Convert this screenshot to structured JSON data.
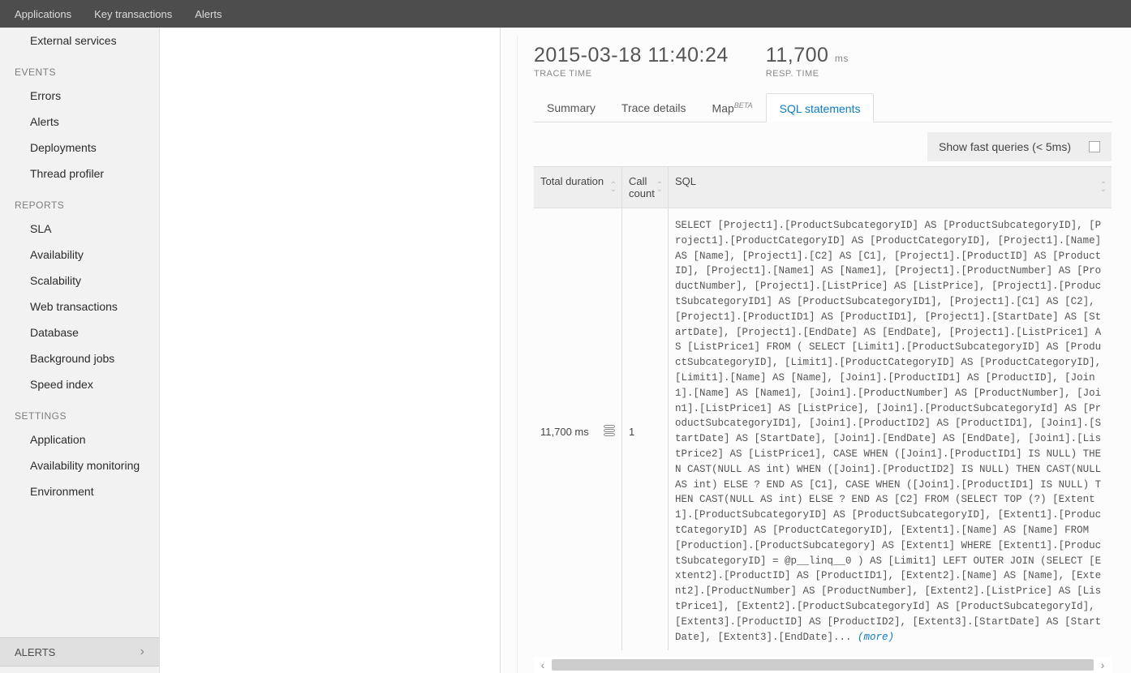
{
  "topnav": {
    "applications": "Applications",
    "key_transactions": "Key transactions",
    "alerts": "Alerts"
  },
  "sidebar": {
    "item_external_services": "External services",
    "section_events": "EVENTS",
    "item_errors": "Errors",
    "item_alerts": "Alerts",
    "item_deployments": "Deployments",
    "item_thread_profiler": "Thread profiler",
    "section_reports": "REPORTS",
    "item_sla": "SLA",
    "item_availability": "Availability",
    "item_scalability": "Scalability",
    "item_web_transactions": "Web transactions",
    "item_database": "Database",
    "item_background_jobs": "Background jobs",
    "item_speed_index": "Speed index",
    "section_settings": "SETTINGS",
    "item_application": "Application",
    "item_availability_monitoring": "Availability monitoring",
    "item_environment": "Environment",
    "footer_alerts": "ALERTS"
  },
  "detail": {
    "trace_time_value": "2015-03-18 11:40:24",
    "trace_time_label": "TRACE TIME",
    "resp_time_value": "11,700",
    "resp_time_unit": "ms",
    "resp_time_label": "RESP. TIME",
    "tabs": {
      "summary": "Summary",
      "trace_details": "Trace details",
      "map": "Map",
      "map_badge": "BETA",
      "sql_statements": "SQL statements"
    },
    "show_fast_queries": "Show fast queries (< 5ms)",
    "columns": {
      "total_duration": "Total duration",
      "call_count": "Call count",
      "sql": "SQL"
    },
    "row0": {
      "duration": "11,700 ms",
      "call_count": "1",
      "sql": "SELECT [Project1].[ProductSubcategoryID] AS [ProductSubcategoryID], [Project1].[ProductCategoryID] AS [ProductCategoryID], [Project1].[Name] AS [Name], [Project1].[C2] AS [C1], [Project1].[ProductID] AS [ProductID], [Project1].[Name1] AS [Name1], [Project1].[ProductNumber] AS [ProductNumber], [Project1].[ListPrice] AS [ListPrice], [Project1].[ProductSubcategoryID1] AS [ProductSubcategoryID1], [Project1].[C1] AS [C2], [Project1].[ProductID1] AS [ProductID1], [Project1].[StartDate] AS [StartDate], [Project1].[EndDate] AS [EndDate], [Project1].[ListPrice1] AS [ListPrice1] FROM ( SELECT [Limit1].[ProductSubcategoryID] AS [ProductSubcategoryID], [Limit1].[ProductCategoryID] AS [ProductCategoryID], [Limit1].[Name] AS [Name], [Join1].[ProductID1] AS [ProductID], [Join1].[Name] AS [Name1], [Join1].[ProductNumber] AS [ProductNumber], [Join1].[ListPrice1] AS [ListPrice], [Join1].[ProductSubcategoryId] AS [ProductSubcategoryID1], [Join1].[ProductID2] AS [ProductID1], [Join1].[StartDate] AS [StartDate], [Join1].[EndDate] AS [EndDate], [Join1].[ListPrice2] AS [ListPrice1], CASE WHEN ([Join1].[ProductID1] IS NULL) THEN CAST(NULL AS int) WHEN ([Join1].[ProductID2] IS NULL) THEN CAST(NULL AS int) ELSE ? END AS [C1], CASE WHEN ([Join1].[ProductID1] IS NULL) THEN CAST(NULL AS int) ELSE ? END AS [C2] FROM (SELECT TOP (?) [Extent1].[ProductSubcategoryID] AS [ProductSubcategoryID], [Extent1].[ProductCategoryID] AS [ProductCategoryID], [Extent1].[Name] AS [Name] FROM [Production].[ProductSubcategory] AS [Extent1] WHERE [Extent1].[ProductSubcategoryID] = @p__linq__0 ) AS [Limit1] LEFT OUTER JOIN (SELECT [Extent2].[ProductID] AS [ProductID1], [Extent2].[Name] AS [Name], [Extent2].[ProductNumber] AS [ProductNumber], [Extent2].[ListPrice] AS [ListPrice1], [Extent2].[ProductSubcategoryId] AS [ProductSubcategoryId], [Extent3].[ProductID] AS [ProductID2], [Extent3].[StartDate] AS [StartDate], [Extent3].[EndDate]... ",
      "more": "(more)"
    }
  }
}
